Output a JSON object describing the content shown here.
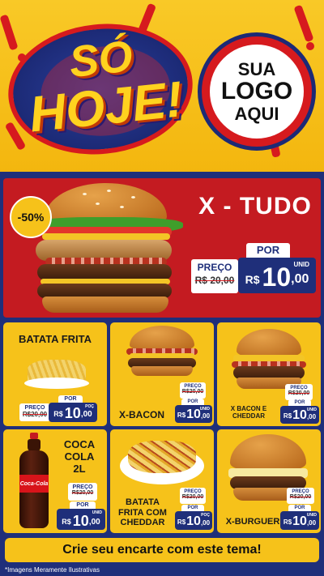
{
  "header": {
    "headline_line1": "SÓ",
    "headline_line2": "HOJE!",
    "logo_line1": "SUA",
    "logo_line2": "LOGO",
    "logo_line3": "AQUI"
  },
  "hero": {
    "title": "X - TUDO",
    "discount": "-50%",
    "preco_label": "PREÇO",
    "old_price": "R$ 20,00",
    "por_label": "POR",
    "currency": "R$",
    "new_price_int": "10",
    "new_price_dec": ",00",
    "unit": "UNID"
  },
  "products": [
    {
      "title": "BATATA FRITA",
      "preco_label": "PREÇO",
      "old_price": "R$20,00",
      "por_label": "POR",
      "currency": "R$",
      "price_int": "10",
      "price_dec": ",00",
      "unit": "POÇ"
    },
    {
      "title": "X-BACON",
      "preco_label": "PREÇO",
      "old_price": "R$20,00",
      "por_label": "POR",
      "currency": "R$",
      "price_int": "10",
      "price_dec": ",00",
      "unit": "UNID"
    },
    {
      "title": "X BACON E CHEDDAR",
      "preco_label": "PREÇO",
      "old_price": "R$20,00",
      "por_label": "POR",
      "currency": "R$",
      "price_int": "10",
      "price_dec": ",00",
      "unit": "UNID"
    },
    {
      "title_l1": "COCA",
      "title_l2": "COLA",
      "title_l3": "2L",
      "preco_label": "PREÇO",
      "old_price": "R$20,00",
      "por_label": "POR",
      "currency": "R$",
      "price_int": "10",
      "price_dec": ",00",
      "unit": "UNID",
      "bottle_brand": "Coca-Cola"
    },
    {
      "title_l1": "BATATA",
      "title_l2": "FRITA COM",
      "title_l3": "CHEDDAR",
      "preco_label": "PREÇO",
      "old_price": "R$20,00",
      "por_label": "POR",
      "currency": "R$",
      "price_int": "10",
      "price_dec": ",00",
      "unit": "POÇ"
    },
    {
      "title": "X-BURGUER",
      "preco_label": "PREÇO",
      "old_price": "R$20,00",
      "por_label": "POR",
      "currency": "R$",
      "price_int": "10",
      "price_dec": ",00",
      "unit": "UNID"
    }
  ],
  "footer": {
    "cta": "Crie seu encarte com este tema!",
    "disclaimer": "*Imagens Meramente Ilustrativas"
  },
  "colors": {
    "yellow": "#f6c21a",
    "red": "#c41b21",
    "navy": "#1f2f7a",
    "white": "#ffffff"
  }
}
